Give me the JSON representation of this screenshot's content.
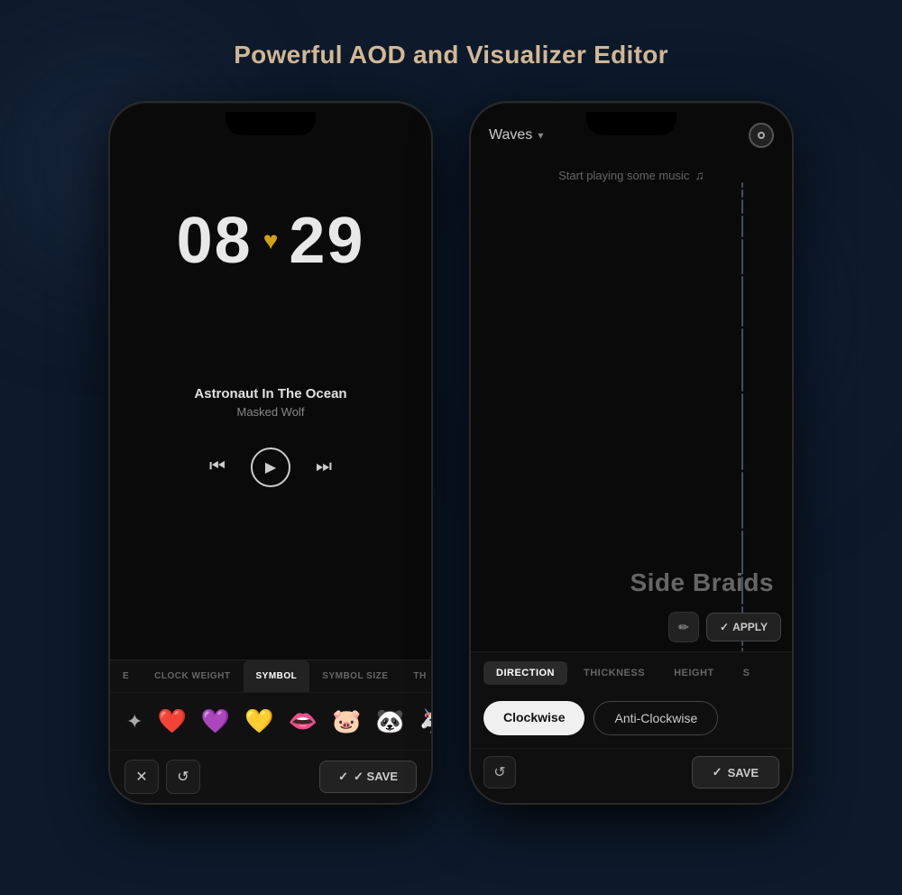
{
  "page": {
    "title": "Powerful AOD and Visualizer Editor"
  },
  "left_phone": {
    "clock": {
      "hours": "08",
      "minutes": "29",
      "separator": "♥"
    },
    "music": {
      "track": "Astronaut In The Ocean",
      "artist": "Masked Wolf"
    },
    "tabs": [
      {
        "label": "E",
        "active": false
      },
      {
        "label": "CLOCK WEIGHT",
        "active": false
      },
      {
        "label": "SYMBOL",
        "active": true
      },
      {
        "label": "SYMBOL SIZE",
        "active": false
      },
      {
        "label": "TH",
        "active": false
      }
    ],
    "symbols": [
      "✦",
      "❤️",
      "💜",
      "💛",
      "👄",
      "🐷",
      "🐼",
      "🦄"
    ],
    "actions": {
      "close_label": "✕",
      "reset_label": "↺",
      "save_label": "✓ SAVE"
    }
  },
  "right_phone": {
    "header": {
      "dropdown_label": "Waves",
      "chevron": "▾"
    },
    "music_prompt": "Start playing some music",
    "visualizer": {
      "title": "Side Braids"
    },
    "direction_tabs": [
      {
        "label": "DIRECTION",
        "active": true
      },
      {
        "label": "THICKNESS",
        "active": false
      },
      {
        "label": "HEIGHT",
        "active": false
      },
      {
        "label": "S",
        "active": false
      }
    ],
    "direction_options": [
      {
        "label": "Clockwise",
        "selected": true
      },
      {
        "label": "Anti-Clockwise",
        "selected": false
      }
    ],
    "actions": {
      "edit_icon": "✏",
      "apply_label": "✓ APPLY",
      "reset_label": "↺",
      "save_label": "✓ SAVE"
    }
  }
}
